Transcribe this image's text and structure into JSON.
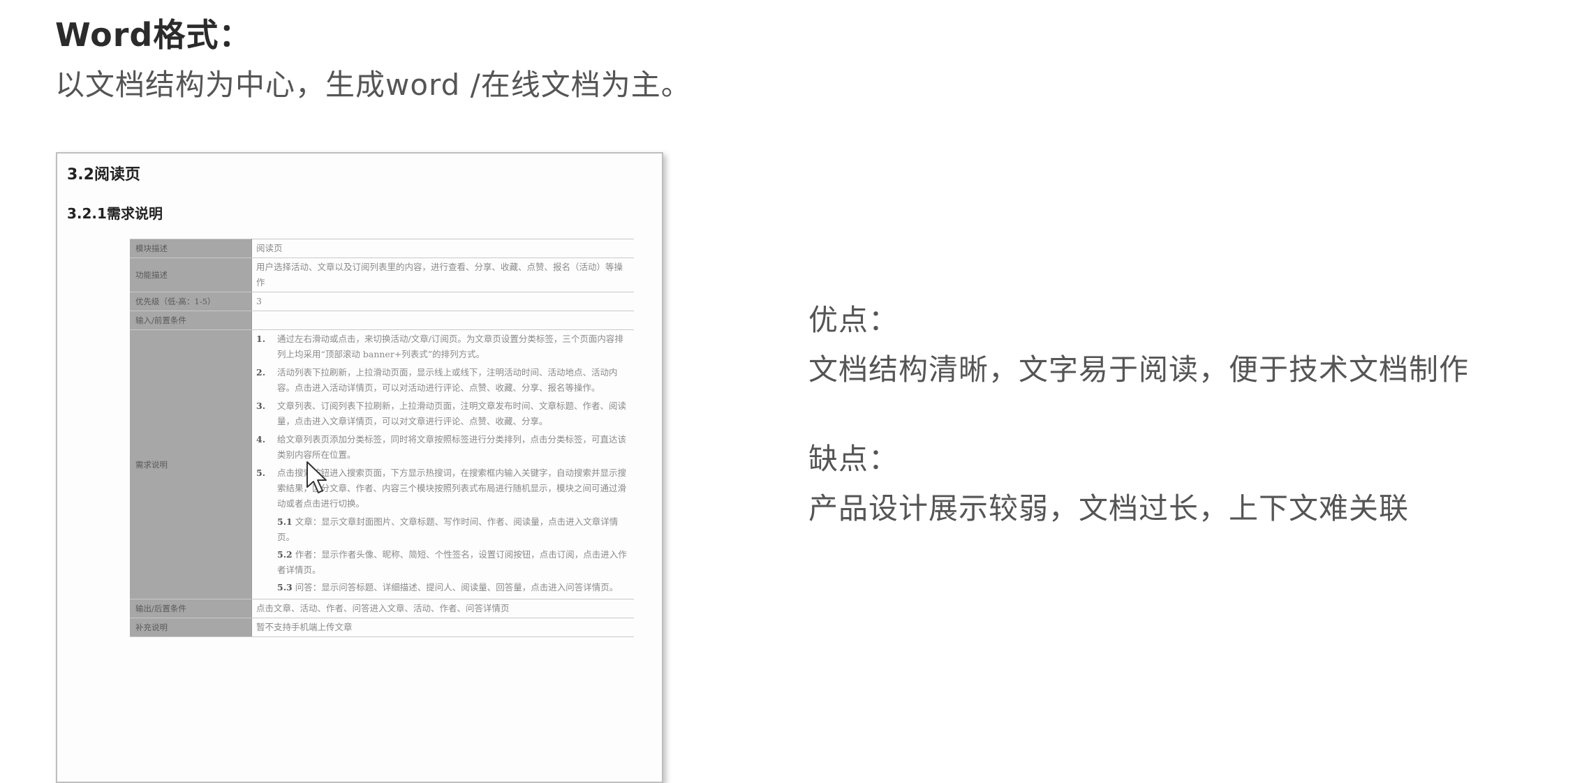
{
  "header": {
    "title": "Word格式：",
    "subtitle": "以文档结构为中心，生成word /在线文档为主。"
  },
  "document": {
    "section_title": "3.2阅读页",
    "subsection_title": "3.2.1需求说明",
    "rows": [
      {
        "label": "模块描述",
        "value": "阅读页"
      },
      {
        "label": "功能描述",
        "value": "用户选择活动、文章以及订阅列表里的内容，进行查看、分享、收藏、点赞、报名（活动）等操作"
      },
      {
        "label": "优先级（低-高：1-5）",
        "value": "3"
      },
      {
        "label": "输入/前置条件",
        "value": ""
      }
    ],
    "requirement_label": "需求说明",
    "requirement_items": [
      {
        "num": "1.",
        "text": "通过左右滑动或点击，来切换活动/文章/订阅页。为文章页设置分类标签，三个页面内容排列上均采用“顶部滚动 banner+列表式”的排列方式。"
      },
      {
        "num": "2.",
        "text": "活动列表下拉刷新，上拉滑动页面，显示线上或线下，注明活动时间、活动地点、活动内容。点击进入活动详情页，可以对活动进行评论、点赞、收藏、分享、报名等操作。"
      },
      {
        "num": "3.",
        "text": "文章列表、订阅列表下拉刷新，上拉滑动页面，注明文章发布时间、文章标题、作者、阅读量，点击进入文章详情页，可以对文章进行评论、点赞、收藏、分享。"
      },
      {
        "num": "4.",
        "text": "给文章列表页添加分类标签，同时将文章按照标签进行分类排列，点击分类标签，可直达该类别内容所在位置。"
      },
      {
        "num": "5.",
        "text": "点击搜索按钮进入搜索页面，下方显示热搜词，在搜索框内输入关键字，自动搜索并显示搜索结果，区分文章、作者、内容三个模块按照列表式布局进行随机显示，模块之间可通过滑动或者点击进行切换。"
      }
    ],
    "requirement_subitems": [
      {
        "num": "5.1",
        "text": "文章：显示文章封面图片、文章标题、写作时间、作者、阅读量，点击进入文章详情页。"
      },
      {
        "num": "5.2",
        "text": "作者：显示作者头像、昵称、简短、个性签名，设置订阅按钮，点击订阅，点击进入作者详情页。"
      },
      {
        "num": "5.3",
        "text": "问答：显示问答标题、详细描述、提问人、阅读量、回答量，点击进入问答详情页。"
      }
    ],
    "bottom_rows": [
      {
        "label": "输出/后置条件",
        "value": "点击文章、活动、作者、问答进入文章、活动、作者、问答详情页"
      },
      {
        "label": "补充说明",
        "value": "暂不支持手机端上传文章"
      }
    ]
  },
  "pros": {
    "title": "优点：",
    "text": "文档结构清晰，文字易于阅读，便于技术文档制作"
  },
  "cons": {
    "title": "缺点：",
    "text": "产品设计展示较弱，文档过长，上下文难关联"
  }
}
